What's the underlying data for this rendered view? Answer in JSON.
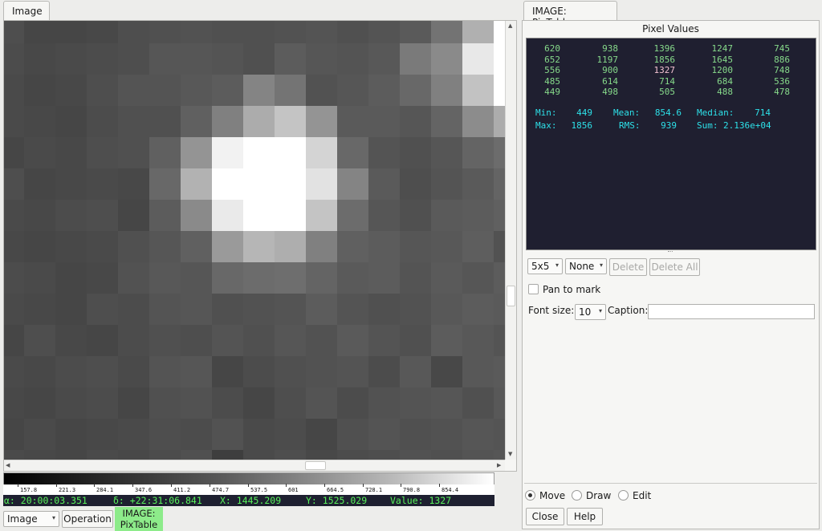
{
  "left_panel": {
    "tab_label": "Image",
    "pixel_grid": [
      [
        78,
        70,
        70,
        72,
        78,
        80,
        82,
        80,
        80,
        82,
        84,
        80,
        84,
        90,
        115,
        176,
        255
      ],
      [
        76,
        72,
        74,
        76,
        78,
        86,
        86,
        84,
        80,
        92,
        86,
        84,
        88,
        122,
        138,
        232,
        255
      ],
      [
        74,
        70,
        72,
        78,
        84,
        84,
        88,
        92,
        132,
        116,
        82,
        86,
        92,
        104,
        128,
        194,
        255
      ],
      [
        74,
        72,
        70,
        76,
        80,
        80,
        96,
        128,
        172,
        196,
        148,
        90,
        90,
        86,
        100,
        140,
        172
      ],
      [
        70,
        74,
        72,
        78,
        80,
        96,
        148,
        242,
        255,
        255,
        212,
        104,
        84,
        80,
        86,
        100,
        108
      ],
      [
        78,
        70,
        72,
        74,
        72,
        104,
        178,
        255,
        255,
        255,
        226,
        132,
        90,
        78,
        84,
        90,
        100
      ],
      [
        74,
        72,
        76,
        78,
        70,
        92,
        138,
        234,
        255,
        255,
        196,
        108,
        86,
        80,
        90,
        92,
        96
      ],
      [
        72,
        70,
        72,
        74,
        80,
        86,
        96,
        154,
        182,
        174,
        128,
        96,
        92,
        86,
        88,
        94,
        82
      ],
      [
        76,
        74,
        70,
        72,
        82,
        88,
        86,
        104,
        108,
        110,
        100,
        90,
        92,
        84,
        90,
        86,
        92
      ],
      [
        74,
        72,
        70,
        78,
        76,
        84,
        86,
        80,
        82,
        84,
        92,
        84,
        80,
        82,
        88,
        92,
        90
      ],
      [
        70,
        78,
        72,
        70,
        76,
        80,
        78,
        84,
        80,
        86,
        82,
        90,
        84,
        80,
        92,
        88,
        84
      ],
      [
        74,
        72,
        76,
        78,
        74,
        84,
        86,
        70,
        76,
        80,
        82,
        84,
        76,
        88,
        72,
        88,
        90
      ],
      [
        72,
        70,
        74,
        76,
        70,
        80,
        82,
        76,
        70,
        78,
        84,
        76,
        82,
        84,
        86,
        80,
        88
      ],
      [
        70,
        74,
        70,
        72,
        74,
        78,
        76,
        82,
        74,
        76,
        70,
        80,
        84,
        80,
        82,
        86,
        84
      ],
      [
        74,
        72,
        70,
        74,
        72,
        76,
        80,
        62,
        74,
        78,
        72,
        76,
        78,
        82,
        80,
        84,
        86
      ]
    ],
    "colorbar_ticks": [
      "157.8",
      "221.3",
      "284.1",
      "347.6",
      "411.2",
      "474.7",
      "537.5",
      "601",
      "664.5",
      "728.1",
      "790.8",
      "854.4"
    ],
    "readout": {
      "ra": "α: 20:00:03.351",
      "dec": "δ: +22:31:06.841",
      "x": "X: 1445.209",
      "y": "Y: 1525.029",
      "value": "Value: 1327"
    },
    "image_combo": "Image",
    "operation_label": "Operation",
    "plugin_tag_line1": "IMAGE:",
    "plugin_tag_line2": "PixTable"
  },
  "right_panel": {
    "tab_label": "IMAGE: PixTable",
    "pixel_values_title": "Pixel Values",
    "rows": [
      [
        "620",
        "938",
        "1396",
        "1247",
        "745"
      ],
      [
        "652",
        "1197",
        "1856",
        "1645",
        "886"
      ],
      [
        "556",
        "900",
        "1327",
        "1200",
        "748"
      ],
      [
        "485",
        "614",
        "714",
        "684",
        "536"
      ],
      [
        "449",
        "498",
        "505",
        "488",
        "478"
      ]
    ],
    "highlight": {
      "row": 2,
      "col": 2
    },
    "stats": {
      "min_label": "Min:",
      "min": "449",
      "mean_label": "Mean:",
      "mean": "854.6",
      "median_label": "Median:",
      "median": "714",
      "max_label": "Max:",
      "max": "1856",
      "rms_label": "RMS:",
      "rms": "939",
      "sum_label": "Sum:",
      "sum": "2.136e+04"
    },
    "size_combo": "5x5",
    "mark_combo": "None",
    "delete_label": "Delete",
    "delete_all_label": "Delete All",
    "pan_label": "Pan to mark",
    "pan_checked": false,
    "font_size_label": "Font size:",
    "font_size_value": "10",
    "caption_label": "Caption:",
    "caption_value": "",
    "modes": [
      "Move",
      "Draw",
      "Edit"
    ],
    "mode_selected": "Move",
    "close_label": "Close",
    "help_label": "Help"
  }
}
